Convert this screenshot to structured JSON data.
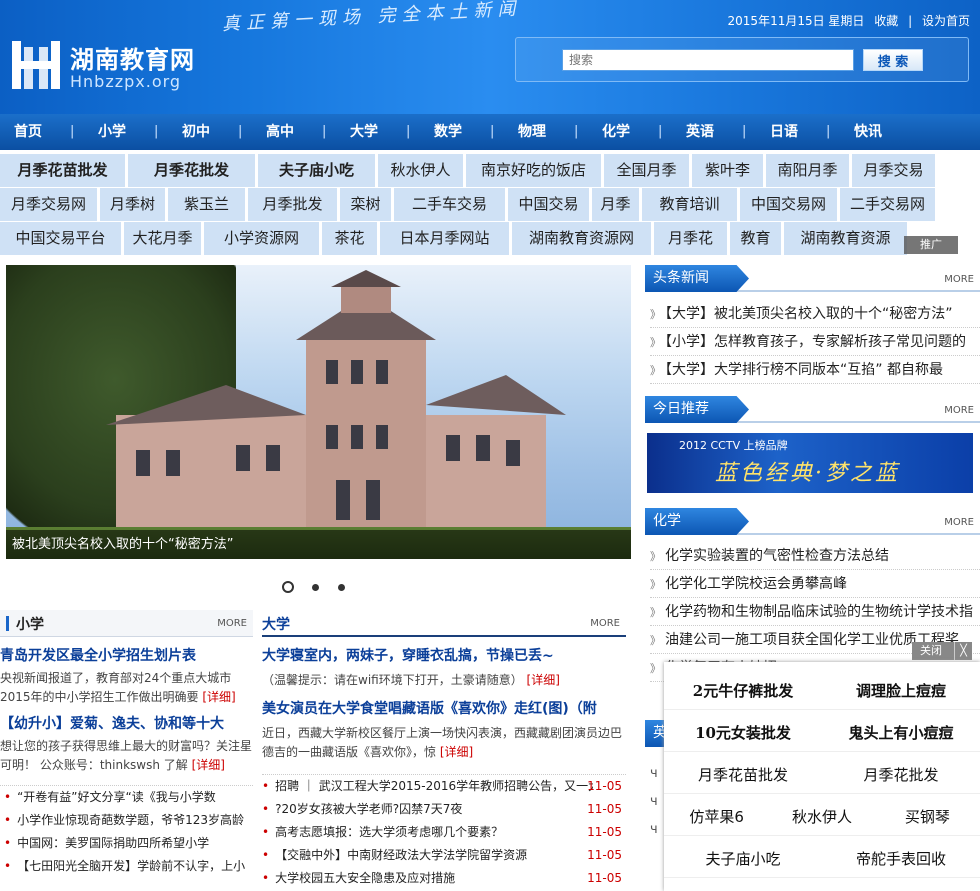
{
  "header": {
    "logo_cn": "湖南教育网",
    "logo_en": "Hnbzzpx.org",
    "slogan": "真正第一现场 完全本土新闻",
    "date": "2015年11月15日 星期日",
    "links": [
      "收藏",
      "设为首页"
    ],
    "link_sep": "|",
    "search_placeholder": "搜索",
    "search_button": "搜 索"
  },
  "nav": [
    "首页",
    "小学",
    "初中",
    "高中",
    "大学",
    "数学",
    "物理",
    "化学",
    "英语",
    "日语",
    "快讯"
  ],
  "tags": [
    [
      "月季花苗批发",
      "月季花批发",
      "夫子庙小吃",
      "秋水伊人",
      "南京好吃的饭店",
      "全国月季",
      "紫叶李",
      "南阳月季",
      "月季交易"
    ],
    [
      "月季交易网",
      "月季树",
      "紫玉兰",
      "月季批发",
      "栾树",
      "二手车交易",
      "中国交易",
      "月季",
      "教育培训",
      "中国交易网",
      "二手交易网"
    ],
    [
      "中国交易平台",
      "大花月季",
      "小学资源网",
      "茶花",
      "日本月季网站",
      "湖南教育资源网",
      "月季花",
      "教育",
      "湖南教育资源"
    ]
  ],
  "ad_badge": "推广",
  "slider": {
    "caption": "被北美顶尖名校入取的十个“秘密方法”",
    "dots": 3,
    "active": 0
  },
  "right": {
    "headline": {
      "title": "头条新闻",
      "more": "MORE",
      "items": [
        "【大学】被北美顶尖名校入取的十个“秘密方法”",
        "【小学】怎样教育孩子，专家解析孩子常见问题的",
        "【大学】大学排行榜不同版本“互掐” 都自称最"
      ]
    },
    "recommend": {
      "title": "今日推荐",
      "more": "MORE",
      "ad_top": "2012 CCTV 上榜品牌",
      "ad_main": "蓝色经典·梦之蓝"
    },
    "chemistry": {
      "title": "化学",
      "more": "MORE",
      "items": [
        "化学实验装置的气密性检查方法总结",
        "化学化工学院校运会勇攀高峰",
        "化学药物和生物制品临床试验的生物统计学技术指",
        "油建公司一施工项目获全国化学工业优质工程奖",
        "化学复习有小妙招"
      ]
    },
    "next_title": "英",
    "next_items_fragments": [
      "ч",
      "ч",
      "ч"
    ]
  },
  "left": {
    "primary": {
      "title": "小学",
      "more": "MORE",
      "lead1": "青岛开发区最全小学招生划片表",
      "lead1_text": "央视新闻报道了，教育部对24个重点大城市2015年的中小学招生工作做出明确要",
      "lead2": "【幼升小】爱菊、逸夫、协和等十大",
      "lead2_text": "想让您的孩子获得思维上最大的财富吗？关注星可明！ 公众账号：thinkswsh 了解",
      "detail": "[详细]",
      "items": [
        "“开卷有益”好文分享“读《我与小学数",
        "小学作业惊现奇葩数学题，爷爷123岁高龄",
        "中国网：美罗国际捐助四所希望小学",
        "【七田阳光全脑开发】学龄前不认字，上小"
      ]
    },
    "university": {
      "title": "大学",
      "more": "MORE",
      "lead1": "大学寝室内，两妹子，穿睡衣乱搞，节操已丢~",
      "lead1_text": "（温馨提示：请在wifi环境下打开，土豪请随意）",
      "lead2": "美女演员在大学食堂唱藏语版《喜欢你》走红(图)（附",
      "lead2_text": "近日，西藏大学新校区餐厅上演一场快闪表演，西藏藏剧团演员边巴德吉的一曲藏语版《喜欢你》，惊",
      "detail": "[详细]",
      "items": [
        {
          "text": "招聘 ｜ 武汉工程大学2015-2016学年教师招聘公告，又一大",
          "date": "11-05"
        },
        {
          "text": "?20岁女孩被大学老师?囚禁7天7夜",
          "date": "11-05"
        },
        {
          "text": "高考志愿填报：选大学须考虑哪几个要素？",
          "date": "11-05"
        },
        {
          "text": "【交融中外】中南财经政法大学法学院留学资源",
          "date": "11-05"
        },
        {
          "text": "大学校园五大安全隐患及应对措施",
          "date": "11-05"
        }
      ]
    }
  },
  "floating_ad": {
    "close": "关闭",
    "close_x": "╳",
    "rows": [
      [
        "2元牛仔裤批发",
        "调理脸上痘痘"
      ],
      [
        "10元女装批发",
        "鬼头上有小痘痘"
      ],
      [
        "月季花苗批发",
        "月季花批发"
      ],
      [
        "仿苹果6",
        "秋水伊人",
        "买钢琴"
      ],
      [
        "夫子庙小吃",
        "帝舵手表回收"
      ]
    ]
  }
}
